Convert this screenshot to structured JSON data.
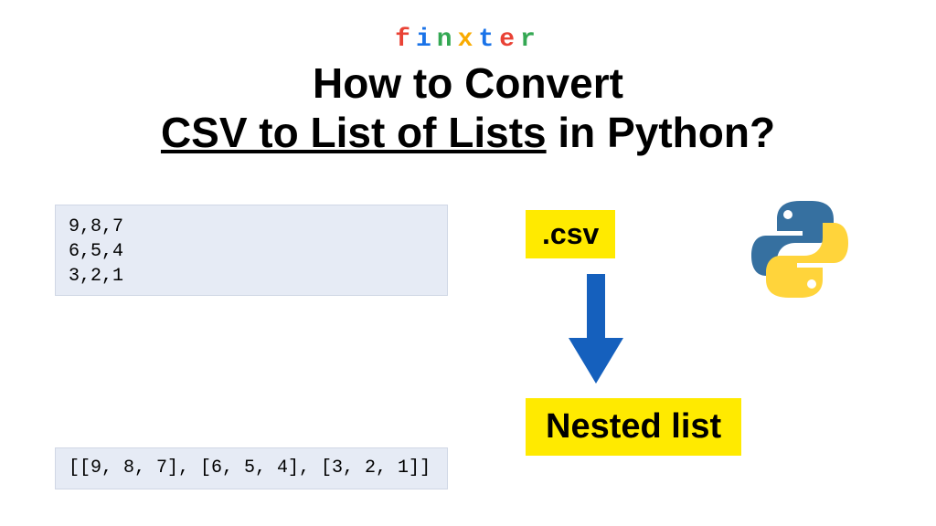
{
  "brand": {
    "letters": [
      "f",
      "i",
      "n",
      "x",
      "t",
      "e",
      "r"
    ]
  },
  "heading": {
    "line1": "How to Convert",
    "underlined": "CSV to List of Lists",
    "line2_suffix": " in Python?"
  },
  "csv": {
    "content": "9,8,7\n6,5,4\n3,2,1"
  },
  "output": {
    "content": "[[9, 8, 7], [6, 5, 4], [3, 2, 1]]"
  },
  "labels": {
    "csv_ext": ".csv",
    "nested": "Nested list"
  },
  "colors": {
    "highlight": "#ffea00",
    "arrow": "#1560bd",
    "codebg": "#e6ebf5"
  }
}
